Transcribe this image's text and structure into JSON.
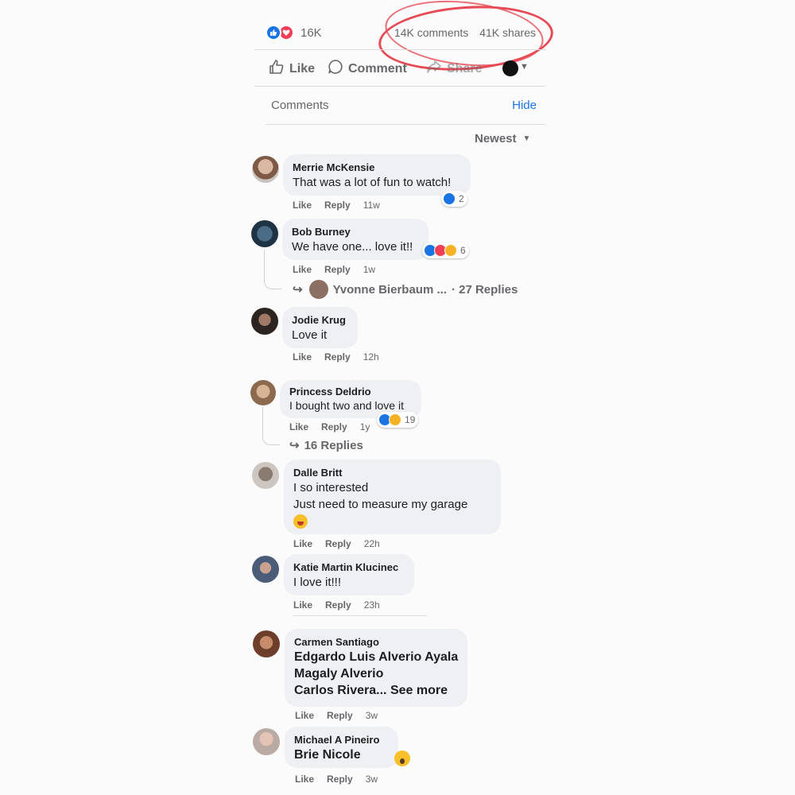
{
  "post": {
    "reaction_count": "16K",
    "comments_count": "14K comments",
    "shares_count": "41K shares",
    "actions": {
      "like": "Like",
      "comment": "Comment",
      "share": "Share"
    },
    "comments_label": "Comments",
    "hide_label": "Hide",
    "sort_label": "Newest"
  },
  "meta_labels": {
    "like": "Like",
    "reply": "Reply"
  },
  "comments": [
    {
      "name": "Merrie McKensie",
      "text": [
        "That was a lot of fun to watch!"
      ],
      "time": "11w",
      "reactions": "2"
    },
    {
      "name": "Bob Burney",
      "text": [
        "We have one... love it!!"
      ],
      "time": "1w",
      "reactions": "6",
      "reply_author": "Yvonne Bierbaum ...",
      "reply_count": "· 27 Replies"
    },
    {
      "name": "Jodie Krug",
      "text": [
        "Love it"
      ],
      "time": "12h"
    },
    {
      "name": "Princess Deldrio",
      "text": [
        "I bought two and love it"
      ],
      "time": "1y",
      "reactions": "19",
      "reply_count": "16 Replies"
    },
    {
      "name": "Dalle Britt",
      "text": [
        "I so interested",
        "Just need to measure my garage"
      ],
      "time": "22h"
    },
    {
      "name": "Katie Martin Klucinec",
      "text": [
        "I love it!!!"
      ],
      "time": "23h"
    },
    {
      "name": "Carmen Santiago",
      "text": [
        "Edgardo Luis Alverio Ayala",
        "Magaly Alverio",
        "Carlos Rivera... See more"
      ],
      "time": "3w"
    },
    {
      "name": "Michael A Pineiro",
      "text": [
        "Brie Nicole"
      ],
      "time": "3w"
    }
  ],
  "colors": {
    "accent": "#1b74e4",
    "annotation": "#e64a55",
    "bubble": "#eff0f3"
  },
  "icons": [
    "like-reaction-icon",
    "love-reaction-icon",
    "thumbs-up-icon",
    "comment-icon",
    "share-icon",
    "caret-down-icon",
    "reply-arrow-icon"
  ]
}
